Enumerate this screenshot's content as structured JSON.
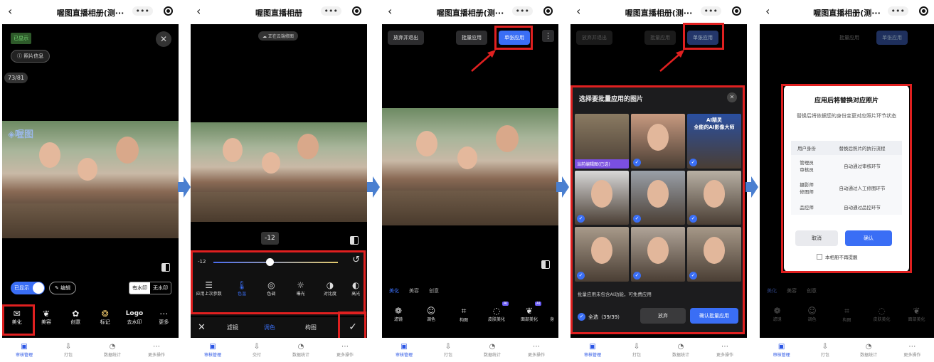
{
  "common": {
    "app_title": "喔图直播相册(测···",
    "app_title_full": "喔图直播相册",
    "tabs": [
      "审核管理",
      "打包",
      "数据统计",
      "更多操作"
    ],
    "tabs_s2": [
      "审核管理",
      "交付",
      "数据统计",
      "更多操作"
    ]
  },
  "s1": {
    "shown_badge": "已显示",
    "photo_info": "照片信息",
    "counter": "73/81",
    "brand": "喔图",
    "toggle": "已显示",
    "edit": "编辑",
    "watermark": "有水印",
    "no_watermark": "无水印",
    "tools": [
      {
        "label": "美化",
        "icon": "beautify-icon"
      },
      {
        "label": "美容",
        "icon": "beauty-icon"
      },
      {
        "label": "创意",
        "icon": "creative-icon"
      },
      {
        "label": "标记",
        "icon": "mark-icon"
      },
      {
        "label": "去水印",
        "icon": "logo-icon"
      },
      {
        "label": "更多",
        "icon": "more-icon"
      }
    ],
    "logo_text": "Logo"
  },
  "s2": {
    "saving": "正在云端修图",
    "value_badge": "-12",
    "slider_value": "-12",
    "slider_fraction": 0.45,
    "tools": [
      "应用上次参数",
      "色温",
      "色调",
      "曝光",
      "对比度",
      "高光"
    ],
    "bottom": [
      "滤镜",
      "调色",
      "构图"
    ]
  },
  "s3": {
    "discard": "放弃并退出",
    "batch": "批量应用",
    "single": "单张应用",
    "tabs": [
      "美化",
      "美容",
      "创意"
    ],
    "tools": [
      "滤镜",
      "调色",
      "构图",
      "皮肤美化",
      "面部美化",
      "身"
    ],
    "ai": "AI"
  },
  "s4": {
    "discard": "放弃并退出",
    "batch": "批量应用",
    "single": "单张应用",
    "sheet_title": "选择要批量应用的图片",
    "current": "当前编辑图(已选)",
    "ai_title1": "AI精灵",
    "ai_title2": "全能的AI影像大师",
    "notice": "批量应用未包含AI功能，可免费应用",
    "select_all": "全选（39/39）",
    "give_up": "放弃",
    "confirm": "确认批量应用"
  },
  "s5": {
    "batch": "批量应用",
    "single": "单张应用",
    "dialog_title": "应用后将替换对应照片",
    "dialog_desc": "替换后将依据您的身份变更对应照片环节状态",
    "col1": "用户身份",
    "col2": "替换后照片的执行流程",
    "rows": [
      {
        "role": "管理员\n审核员",
        "flow": "自动通过审核环节"
      },
      {
        "role": "摄影师\n修图师",
        "flow": "自动通过人工修图环节"
      },
      {
        "role": "品控师",
        "flow": "自动通过品控环节"
      }
    ],
    "cancel": "取消",
    "ok": "确认",
    "no_remind": "本相册不再提醒",
    "tabs": [
      "美化",
      "美容",
      "创意"
    ],
    "tools": [
      "滤镜",
      "调色",
      "构图",
      "皮肤美化",
      "面部美化"
    ]
  }
}
